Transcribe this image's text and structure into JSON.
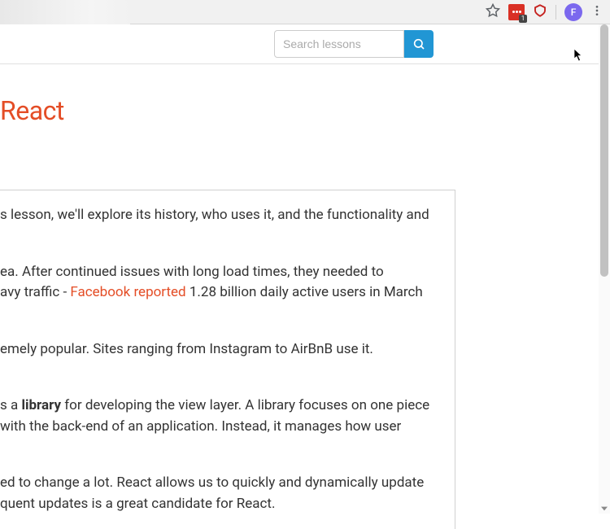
{
  "chrome": {
    "avatar_letter": "F",
    "ext_badge_count": "1"
  },
  "search": {
    "placeholder": "Search lessons"
  },
  "page": {
    "title": "React"
  },
  "content": {
    "p1_a": "s lesson, we'll explore its history, who uses it, and the functionality and",
    "p2_a": "ea. After continued issues with long load times, they needed to",
    "p2_b": "avy traffic - ",
    "p2_link": "Facebook reported",
    "p2_c": " 1.28 billion daily active users in March",
    "p3": "emely popular. Sites ranging from Instagram to AirBnB use it.",
    "p4_a": "s a ",
    "p4_strong": "library",
    "p4_b": " for developing the view layer. A library focuses on one piece",
    "p4_c": "with the back-end of an application. Instead, it manages how user",
    "p5_a": "ed to change a lot. React allows us to quickly and dynamically update",
    "p5_b": "quent updates is a great candidate for React."
  }
}
